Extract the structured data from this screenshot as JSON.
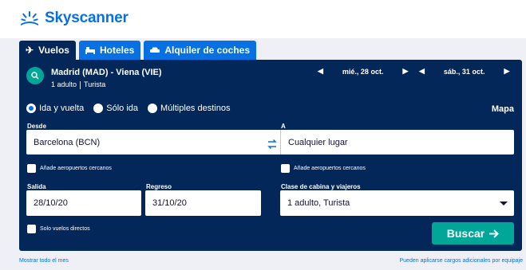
{
  "brand": {
    "name": "Skyscanner",
    "color": "#0770e3"
  },
  "tabs": [
    {
      "label": "Vuelos",
      "icon": "plane-icon",
      "active": true
    },
    {
      "label": "Hoteles",
      "icon": "bed-icon",
      "active": false
    },
    {
      "label": "Alquiler de coches",
      "icon": "car-icon",
      "active": false
    }
  ],
  "summary": {
    "route": "Madrid (MAD) - Viena (VIE)",
    "passengers": "1 adulto",
    "cabin": "Turista",
    "outbound_date": "mié., 28 oct.",
    "return_date": "sáb., 31 oct."
  },
  "trip_types": [
    {
      "label": "Ida y vuelta",
      "selected": true
    },
    {
      "label": "Sólo ida",
      "selected": false
    },
    {
      "label": "Múltiples destinos",
      "selected": false
    }
  ],
  "map_link": "Mapa",
  "form": {
    "from_label": "Desde",
    "from_value": "Barcelona (BCN)",
    "to_label": "A",
    "to_value": "Cualquier lugar",
    "nearby_from": "Añade aeropuertos cercanos",
    "nearby_to": "Añade aeropuertos cercanos",
    "depart_label": "Salida",
    "depart_value": "28/10/20",
    "return_label": "Regreso",
    "return_value": "31/10/20",
    "cabin_label": "Clase de cabina y viajeros",
    "cabin_value": "1 adulto, Turista",
    "direct_only": "Solo vuelos directos",
    "search_label": "Buscar"
  },
  "footer": {
    "show_all_month": "Mostrar todo el mes",
    "baggage_note": "Pueden aplicarse cargos adicionales por equipaje"
  },
  "colors": {
    "panel": "#042759",
    "tab": "#0770e3",
    "accent": "#00a698",
    "page_bg": "#eef0f6"
  }
}
